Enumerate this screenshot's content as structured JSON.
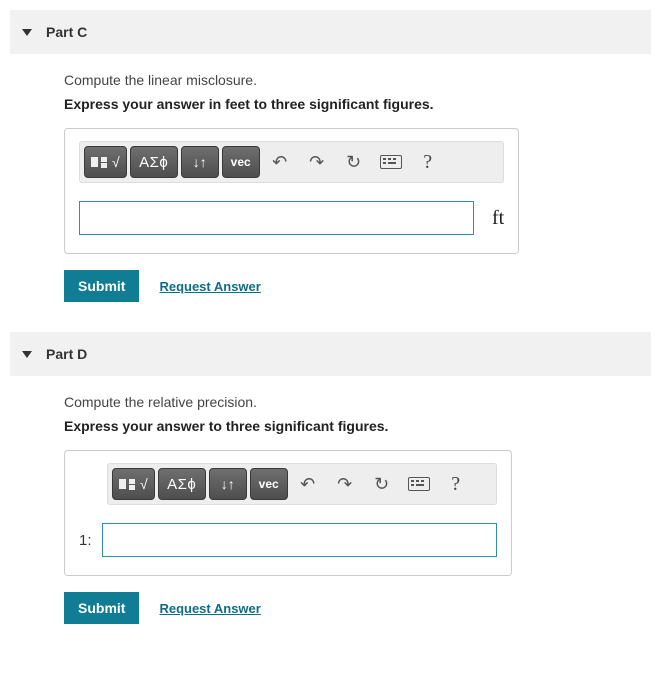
{
  "parts": [
    {
      "title": "Part C",
      "prompt": "Compute the linear misclosure.",
      "instruction": "Express your answer in feet to three significant figures.",
      "prefix": "",
      "unit": "ft",
      "toolbar": {
        "templates": "templates",
        "greek": "ΑΣϕ",
        "subscript": "↓↑",
        "vec": "vec",
        "undo": "↶",
        "redo": "↷",
        "reset": "↻",
        "keyboard": "keyboard",
        "help": "?"
      },
      "submit": "Submit",
      "request": "Request Answer",
      "value": ""
    },
    {
      "title": "Part D",
      "prompt": "Compute the relative precision.",
      "instruction": "Express your answer to three significant figures.",
      "prefix": "1:",
      "unit": "",
      "toolbar": {
        "templates": "templates",
        "greek": "ΑΣϕ",
        "subscript": "↓↑",
        "vec": "vec",
        "undo": "↶",
        "redo": "↷",
        "reset": "↻",
        "keyboard": "keyboard",
        "help": "?"
      },
      "submit": "Submit",
      "request": "Request Answer",
      "value": ""
    }
  ]
}
